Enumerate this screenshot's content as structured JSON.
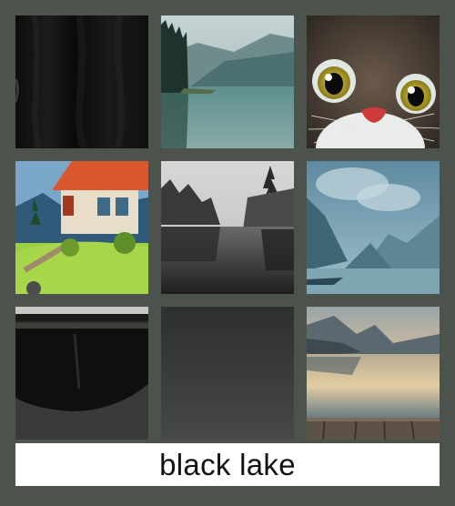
{
  "caption": {
    "text": "black lake"
  },
  "grid": {
    "tiles": [
      {
        "subject": "dark-fabric-texture"
      },
      {
        "subject": "misty-mountain-lake"
      },
      {
        "subject": "cartoon-cat-face"
      },
      {
        "subject": "cottage-on-hill"
      },
      {
        "subject": "misty-forest-lake-monochrome"
      },
      {
        "subject": "blue-mountain-lake-painting"
      },
      {
        "subject": "dark-bowl-closeup"
      },
      {
        "subject": "dark-gray-gradient"
      },
      {
        "subject": "sunset-lake-with-dock"
      }
    ]
  },
  "colors": {
    "background": "#4c534d",
    "caption_background": "#ffffff",
    "caption_text": "#111111"
  }
}
